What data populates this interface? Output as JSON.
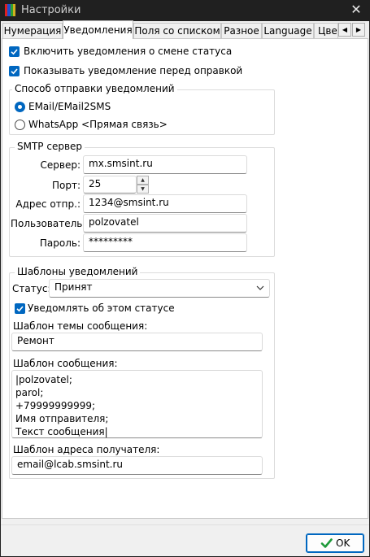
{
  "window": {
    "title": "Настройки",
    "close_glyph": "✕"
  },
  "tabs": [
    "Нумерация",
    "Уведомления",
    "Поля со списком",
    "Разное",
    "Language",
    "Цвет"
  ],
  "tab_scroll": {
    "left": "◀",
    "right": "▶"
  },
  "checkboxes": {
    "enable_notifications": "Включить уведомления о смене статуса",
    "show_before_send": "Показывать уведомление перед оправкой"
  },
  "send_method": {
    "title": "Способ отправки уведомлений",
    "options": [
      "EMail/EMail2SMS",
      "WhatsApp <Прямая связь>"
    ],
    "selected": "EMail/EMail2SMS"
  },
  "smtp": {
    "title": "SMTP сервер",
    "server_label": "Сервер:",
    "server_value": "mx.smsint.ru",
    "port_label": "Порт:",
    "port_value": "25",
    "sender_label": "Адрес отпр.:",
    "sender_value": "1234@smsint.ru",
    "user_label": "Пользователь:",
    "user_value": "polzovatel",
    "password_label": "Пароль:",
    "password_value": "*********"
  },
  "templates": {
    "title": "Шаблоны уведомлений",
    "status_label": "Статус:",
    "status_value": "Принят",
    "notify_checkbox": "Уведомлять об этом статусе",
    "subject_label": "Шаблон темы сообщения:",
    "subject_value": "Ремонт",
    "body_label": "Шаблон сообщения:",
    "body_value": "|polzovatel;\nparol;\n+79999999999;\nИмя отправителя;\nТекст сообщения|",
    "recipient_label": "Шаблон адреса получателя:",
    "recipient_value": "email@lcab.smsint.ru"
  },
  "footer": {
    "ok_label": "OK"
  },
  "colors": {
    "accent": "#0067c0",
    "titlebar": "#202020",
    "ok_check": "#1e9a3a"
  }
}
